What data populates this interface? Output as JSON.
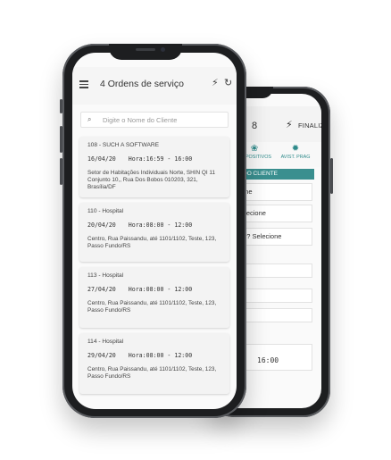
{
  "back_screen": {
    "header_count": "8",
    "finalizar_label": "FINALIZAR",
    "tabs": [
      {
        "icon": "paw-icon",
        "label": "DISPOSITIVOS"
      },
      {
        "icon": "bug-icon",
        "label": "AVIST. PRAG"
      }
    ],
    "section_bar": "DO CLIENTE",
    "fields": [
      "one",
      "elecione",
      "to? Selecione"
    ],
    "time": "16:00"
  },
  "front_screen": {
    "title": "4 Ordens de serviço",
    "search_placeholder": "Digite o Nome do Cliente",
    "orders": [
      {
        "client": "108 - SUCH A SOFTWARE",
        "date": "16/04/20",
        "time": "Hora:16:59 - 16:00",
        "address": "Setor de Habitações Individuais Norte, SHIN QI 11 Conjunto 10,, Rua Dos Bobos 010203, 321, Brasília/DF"
      },
      {
        "client": "110 - Hospital",
        "date": "20/04/20",
        "time": "Hora:08:00 - 12:00",
        "address": "Centro, Rua Paissandu, até 1101/1102, Teste, 123, Passo Fundo/RS"
      },
      {
        "client": "113 - Hospital",
        "date": "27/04/20",
        "time": "Hora:08:00 - 12:00",
        "address": "Centro, Rua Paissandu, até 1101/1102, Teste, 123, Passo Fundo/RS"
      },
      {
        "client": "114 - Hospital",
        "date": "29/04/20",
        "time": "Hora:08:00 - 12:00",
        "address": "Centro, Rua Paissandu, até 1101/1102, Teste, 123, Passo Fundo/RS"
      }
    ]
  }
}
